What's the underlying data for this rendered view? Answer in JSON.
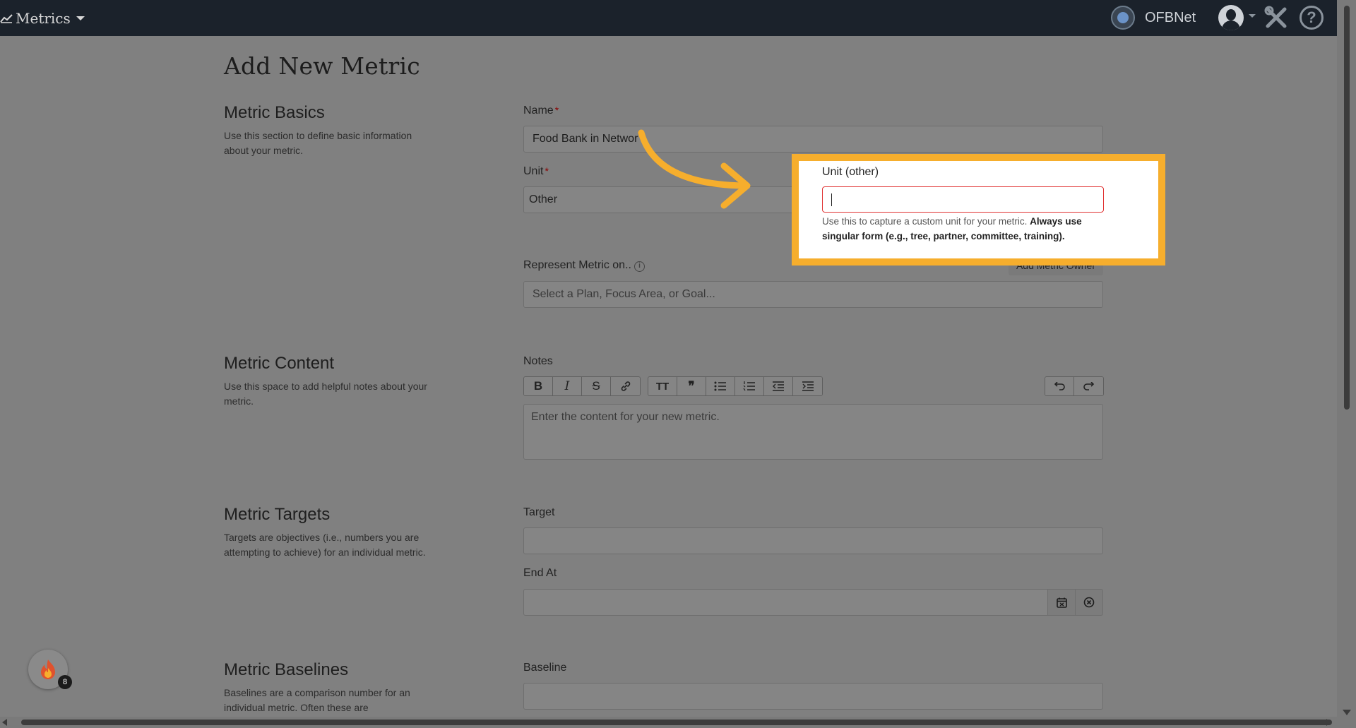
{
  "nav": {
    "app_name": "Metrics",
    "org_name": "OFBNet",
    "icons": [
      "chart-line-icon",
      "caret-down-icon",
      "org-logo-icon",
      "user-avatar-icon",
      "tools-icon",
      "help-icon"
    ]
  },
  "page": {
    "title": "Add New Metric"
  },
  "sections": {
    "basics": {
      "title": "Metric Basics",
      "description": "Use this section to define basic information about your metric."
    },
    "content": {
      "title": "Metric Content",
      "description": "Use this space to add helpful notes about your metric."
    },
    "targets": {
      "title": "Metric Targets",
      "description": "Targets are objectives (i.e., numbers you are attempting to achieve) for an individual metric."
    },
    "baselines": {
      "title": "Metric Baselines",
      "description": "Baselines are a comparison number for an individual metric. Often these are"
    }
  },
  "form": {
    "name_label": "Name",
    "name_value": "Food Bank in Networ",
    "required_mark": "*",
    "unit_label": "Unit",
    "unit_value": "Other",
    "represent_label": "Represent Metric on..",
    "represent_info": "i",
    "add_owner_label": "Add Metric Owner",
    "represent_placeholder": "Select a Plan, Focus Area, or Goal...",
    "notes_label": "Notes",
    "notes_placeholder": "Enter the content for your new metric.",
    "target_label": "Target",
    "end_at_label": "End At",
    "baseline_label": "Baseline"
  },
  "toolbar": {
    "bold": "B",
    "italic": "I",
    "strike": "S",
    "heading": "TT",
    "quote": "❞"
  },
  "callout": {
    "label": "Unit (other)",
    "help_text": "Use this to capture a custom unit for your metric. ",
    "help_bold": "Always use singular form (e.g., tree, partner, committee, training)."
  },
  "badge": {
    "count": "8"
  },
  "colors": {
    "nav_bg": "#1b222b",
    "highlight": "#f6ae2d",
    "error_border": "#e03131",
    "required": "#8b0000"
  }
}
